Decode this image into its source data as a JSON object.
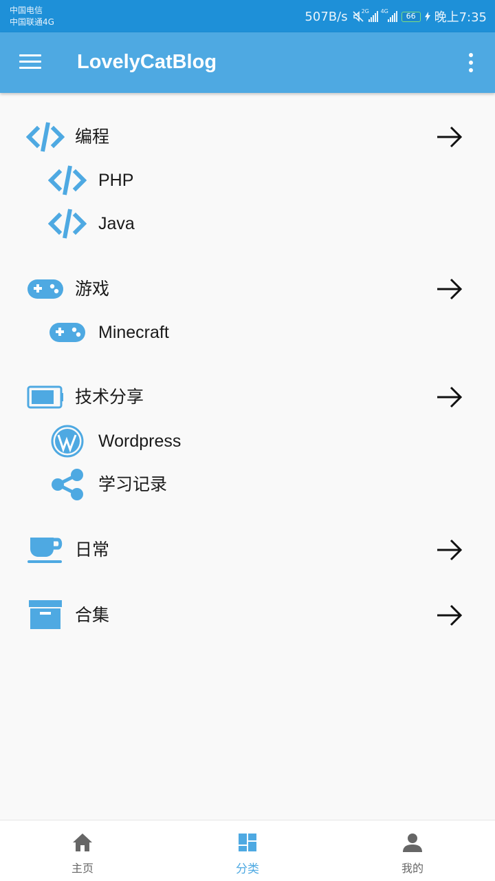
{
  "status_bar": {
    "carrier1": "中国电信",
    "carrier2": "中国联通4G",
    "net_speed": "507B/s",
    "sig1_label": "2G",
    "sig2_label": "4G",
    "battery": "66",
    "time": "晚上7:35"
  },
  "appbar": {
    "title": "LovelyCatBlog",
    "menu_icon": "hamburger-menu-icon",
    "more_icon": "more-vert-icon"
  },
  "categories": [
    {
      "label": "编程",
      "icon": "code-icon",
      "children": [
        {
          "label": "PHP",
          "icon": "code-icon"
        },
        {
          "label": "Java",
          "icon": "code-icon"
        }
      ]
    },
    {
      "label": "游戏",
      "icon": "gamepad-icon",
      "children": [
        {
          "label": "Minecraft",
          "icon": "gamepad-icon"
        }
      ]
    },
    {
      "label": "技术分享",
      "icon": "battery-icon",
      "children": [
        {
          "label": "Wordpress",
          "icon": "wordpress-icon"
        },
        {
          "label": "学习记录",
          "icon": "share-icon"
        }
      ]
    },
    {
      "label": "日常",
      "icon": "coffee-cup-icon",
      "children": []
    },
    {
      "label": "合集",
      "icon": "archive-box-icon",
      "children": []
    }
  ],
  "bottom_nav": [
    {
      "label": "主页",
      "icon": "home-icon",
      "active": false
    },
    {
      "label": "分类",
      "icon": "dashboard-icon",
      "active": true
    },
    {
      "label": "我的",
      "icon": "person-icon",
      "active": false
    }
  ],
  "colors": {
    "statusbar": "#1e90d8",
    "appbar": "#4ea9e2",
    "icon_blue": "#4ea9e2",
    "background": "#f9f9f9"
  }
}
